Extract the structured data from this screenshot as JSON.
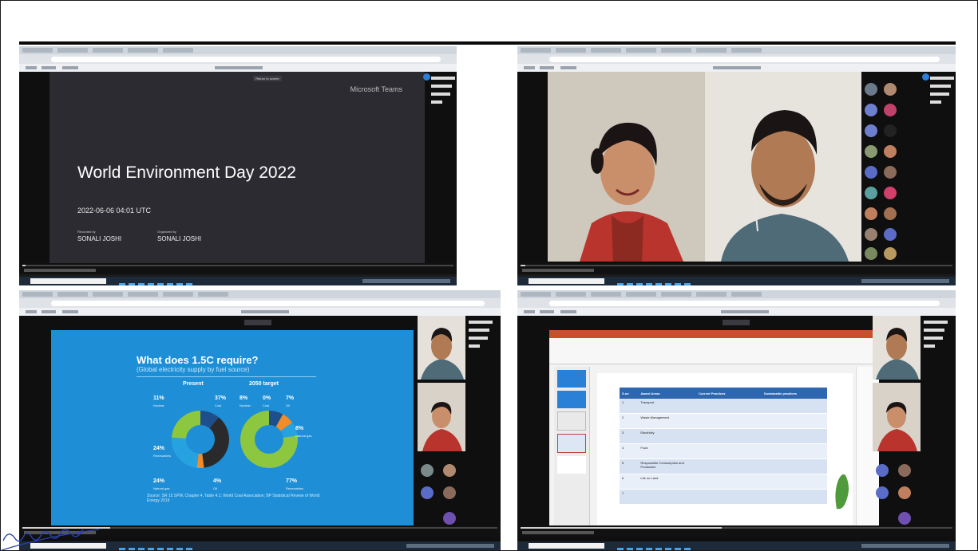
{
  "panel1": {
    "banner_button": "Return to screen",
    "brand": "Microsoft Teams",
    "title": "World Environment Day 2022",
    "date": "2022-06-06 04:01 UTC",
    "recorded_by_label": "Recorded by",
    "organized_by_label": "Organized by",
    "recorded_by": "SONALI JOSHI",
    "organized_by": "SONALI JOSHI"
  },
  "panel3": {
    "heading": "What does 1.5C require?",
    "subheading": "(Global electricity supply by fuel source)",
    "present_label": "Present",
    "target_label": "2050 target",
    "present": [
      {
        "pct": "11%",
        "name": "Nuclear",
        "value": 11,
        "color": "#1f4f8a"
      },
      {
        "pct": "37%",
        "name": "Coal",
        "value": 37,
        "color": "#2a2a2a"
      },
      {
        "pct": "4%",
        "name": "Oil",
        "value": 4,
        "color": "#f28c28"
      },
      {
        "pct": "24%",
        "name": "Natural gas",
        "value": 24,
        "color": "#27a2e0"
      },
      {
        "pct": "24%",
        "name": "Renewables",
        "value": 24,
        "color": "#8dc63f"
      }
    ],
    "target": [
      {
        "pct": "8%",
        "name": "Nuclear",
        "value": 8,
        "color": "#1f4f8a"
      },
      {
        "pct": "0%",
        "name": "Coal",
        "value": 0,
        "color": "#2a2a2a"
      },
      {
        "pct": "7%",
        "name": "Oil",
        "value": 7,
        "color": "#f28c28"
      },
      {
        "pct": "8%",
        "name": "Natural gas",
        "value": 8,
        "color": "#27a2e0"
      },
      {
        "pct": "77%",
        "name": "Renewables",
        "value": 77,
        "color": "#8dc63f"
      }
    ],
    "source": "Source: SR 15 SPM, Chapter 4, Table 4.1; World Coal Association; BP Statistical Review of World Energy 2019"
  },
  "panel4": {
    "col_headers": [
      "S.no",
      "Award Areas",
      "Current Practices",
      "Sustainable practices"
    ],
    "rows": [
      {
        "no": "1",
        "area": "Transport"
      },
      {
        "no": "2",
        "area": "Waste Management"
      },
      {
        "no": "3",
        "area": "Electricity"
      },
      {
        "no": "4",
        "area": "Food"
      },
      {
        "no": "5",
        "area": "Responsible Consumption and Production"
      },
      {
        "no": "6",
        "area": "Life on Land"
      },
      {
        "no": "7",
        "area": ""
      }
    ]
  },
  "signature": "Sonali Joshi"
}
